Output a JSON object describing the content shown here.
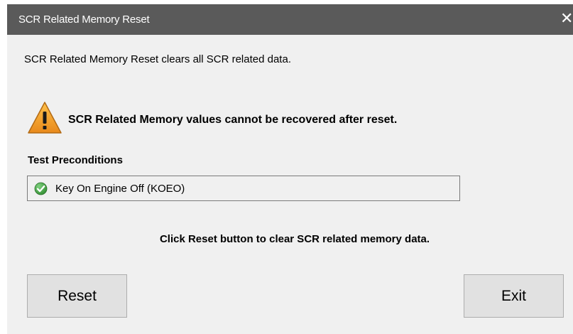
{
  "window": {
    "title": "SCR Related Memory Reset",
    "close_glyph": "✕"
  },
  "description": "SCR Related Memory Reset clears all SCR related data.",
  "warning": {
    "icon": "warning-triangle-icon",
    "text": "SCR Related Memory values cannot be recovered after reset."
  },
  "preconditions": {
    "heading": "Test Preconditions",
    "items": [
      {
        "icon": "check-circle-icon",
        "status": "satisfied",
        "label": "Key On Engine Off (KOEO)"
      }
    ]
  },
  "instruction": "Click Reset button to clear SCR related memory data.",
  "buttons": {
    "reset_label": "Reset",
    "exit_label": "Exit"
  },
  "colors": {
    "titlebar": "#5a5a5a",
    "window_bg": "#f0f0f0",
    "warning_fill": "#f0a030",
    "check_fill": "#3a9a3a"
  }
}
